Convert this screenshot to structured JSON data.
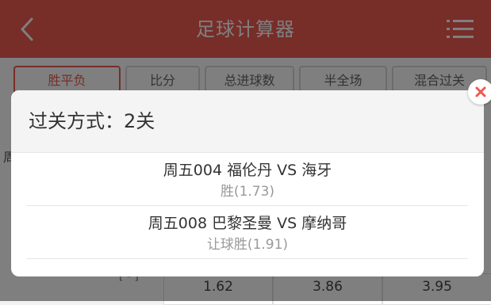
{
  "colors": {
    "accent": "#ee5a50",
    "header_text": "#ffffff",
    "overlay": "rgba(0,0,0,0.5)"
  },
  "header": {
    "title": "足球计算器",
    "back_icon": "chevron-left-icon",
    "menu_icon": "list-menu-icon"
  },
  "tabs": [
    {
      "label": "胜平负",
      "active": true
    },
    {
      "label": "比分",
      "active": false
    },
    {
      "label": "总进球数",
      "active": false
    },
    {
      "label": "半全场",
      "active": false
    },
    {
      "label": "混合过关",
      "active": false
    }
  ],
  "background": {
    "side_text": "周",
    "bracket_text": "[ - ]",
    "odds": [
      "1.62",
      "3.86",
      "3.95"
    ]
  },
  "popup": {
    "title": "过关方式：2关",
    "close_icon": "close-icon",
    "matches": [
      {
        "match": "周五004 福伦丹 VS 海牙",
        "pick": "胜(1.73)"
      },
      {
        "match": "周五008 巴黎圣曼 VS 摩纳哥",
        "pick": "让球胜(1.91)"
      }
    ]
  }
}
